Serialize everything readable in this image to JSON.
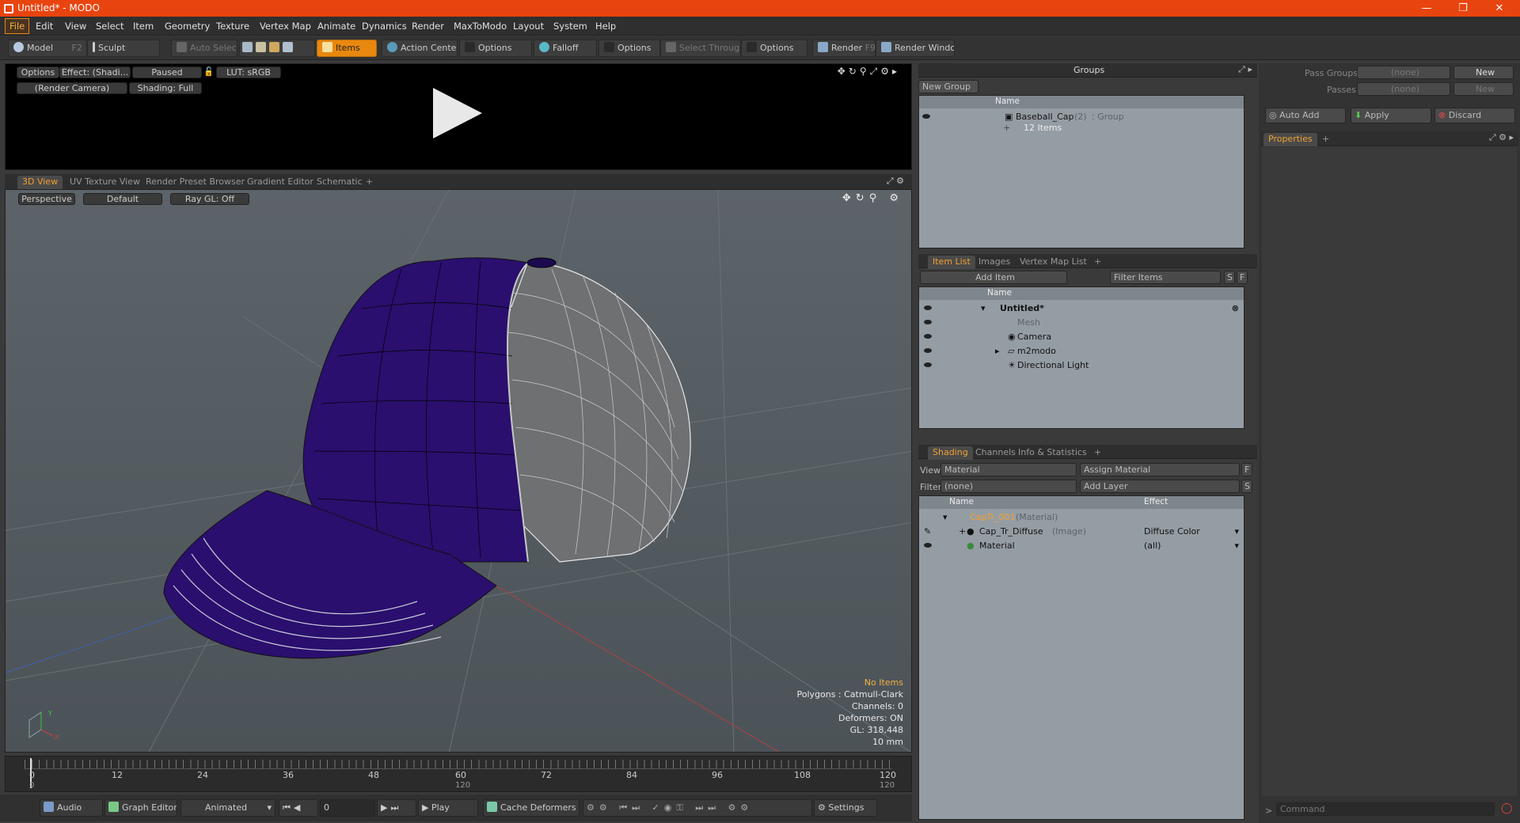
{
  "window": {
    "title": "Untitled* - MODO",
    "min": "—",
    "restore": "❐",
    "close": "✕"
  },
  "menu": [
    "File",
    "Edit",
    "View",
    "Select",
    "Item",
    "Geometry",
    "Texture",
    "Vertex Map",
    "Animate",
    "Dynamics",
    "Render",
    "MaxToModo",
    "Layout",
    "System",
    "Help"
  ],
  "toolbar": {
    "model": "Model",
    "model_key": "F2",
    "sculpt": "Sculpt",
    "auto_select": "Auto Select",
    "items": "Items",
    "action_center": "Action Center",
    "options1": "Options",
    "falloff": "Falloff",
    "options2": "Options",
    "select_through": "Select Through",
    "options3": "Options",
    "render": "Render",
    "render_key": "F9",
    "render_window": "Render Window"
  },
  "preview": {
    "options": "Options",
    "effect": "Effect: (Shadi...",
    "paused": "Paused",
    "lut": "LUT: sRGB",
    "camera": "(Render Camera)",
    "shading": "Shading: Full"
  },
  "viewport_tabs": [
    "3D View",
    "UV Texture View",
    "Render Preset Browser",
    "Gradient Editor",
    "Schematic",
    "+"
  ],
  "viewport": {
    "perspective": "Perspective",
    "default": "Default",
    "raygl": "Ray GL: Off",
    "info_title": "No Items",
    "info_lines": [
      "Polygons : Catmull-Clark",
      "Channels: 0",
      "Deformers: ON",
      "GL: 318,448",
      "10 mm"
    ],
    "axis_x": "X",
    "axis_y": "Y"
  },
  "timeline": {
    "ticks": [
      "0",
      "12",
      "24",
      "36",
      "48",
      "60",
      "72",
      "84",
      "96",
      "108",
      "120"
    ],
    "end_a": "120",
    "end_b": "120",
    "mid": "120"
  },
  "bottombar": {
    "audio": "Audio",
    "graph_editor": "Graph Editor",
    "animated": "Animated",
    "frame": "0",
    "play": "Play",
    "cache_deformers": "Cache Deformers",
    "settings": "Settings"
  },
  "groups": {
    "title": "Groups",
    "new_group": "New Group",
    "col_name": "Name",
    "item_name": "Baseball_Cap",
    "item_count": "(2)",
    "item_type": ": Group",
    "item_sub": "12 Items"
  },
  "item_list": {
    "tabs": [
      "Item List",
      "Images",
      "Vertex Map List",
      "+"
    ],
    "add_item": "Add Item",
    "filter": "Filter Items",
    "s": "S",
    "f": "F",
    "col_name": "Name",
    "rows": [
      "Untitled*",
      "Mesh",
      "Camera",
      "m2modo",
      "Directional Light"
    ]
  },
  "shading": {
    "tabs": [
      "Shading",
      "Channels",
      "Info & Statistics",
      "+"
    ],
    "view_label": "View",
    "view_value": "Material",
    "assign_material": "Assign Material",
    "f": "F",
    "filter_label": "Filter",
    "filter_value": "(none)",
    "add_layer": "Add Layer",
    "s": "S",
    "col_name": "Name",
    "col_effect": "Effect",
    "rows": [
      {
        "name": "CapTr_001",
        "type": "(Material)",
        "effect": ""
      },
      {
        "name": "Cap_Tr_Diffuse",
        "type": "(Image)",
        "effect": "Diffuse Color"
      },
      {
        "name": "Material",
        "type": "",
        "effect": "(all)"
      }
    ]
  },
  "passes": {
    "pass_groups": "Pass Groups",
    "passes": "Passes",
    "none1": "(none)",
    "none2": "(none)",
    "new1": "New",
    "new2": "New",
    "auto_add": "Auto Add",
    "apply": "Apply",
    "discard": "Discard",
    "properties": "Properties",
    "plus": "+",
    "command": "Command"
  },
  "colors": {
    "accent": "#e8880f",
    "title_bar": "#e8440f",
    "cap_front": "#2a0f6e"
  }
}
